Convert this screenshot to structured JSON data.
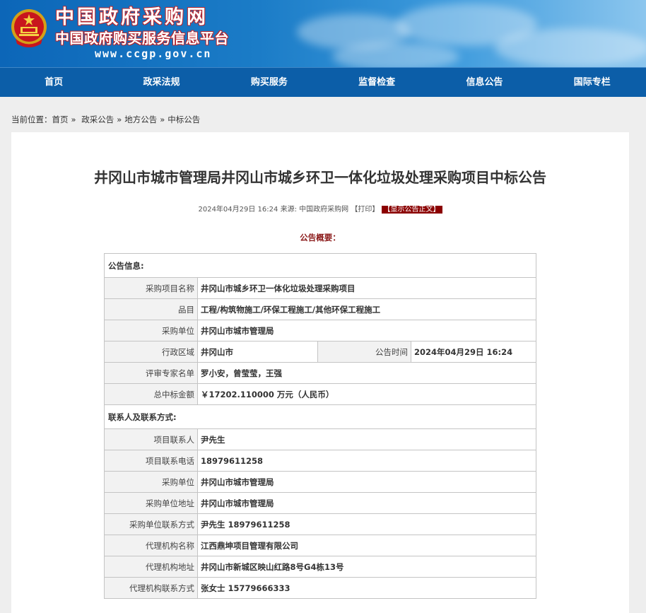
{
  "header": {
    "title_cn": "中国政府采购网",
    "subtitle_cn": "中国政府购买服务信息平台",
    "url": "www.ccgp.gov.cn"
  },
  "nav": [
    "首页",
    "政采法规",
    "购买服务",
    "监督检查",
    "信息公告",
    "国际专栏"
  ],
  "breadcrumb": {
    "label": "当前位置：",
    "items": [
      "首页",
      "政采公告",
      "地方公告",
      "中标公告"
    ]
  },
  "article": {
    "title": "井冈山市城市管理局井冈山市城乡环卫一体化垃圾处理采购项目中标公告",
    "date": "2024年04月29日 16:24",
    "source_label": "来源:",
    "source": "中国政府采购网",
    "print": "【打印】",
    "show_text": "【显示公告正文】",
    "summary_label": "公告概要："
  },
  "info": {
    "section1": "公告信息:",
    "project_name_label": "采购项目名称",
    "project_name": "井冈山市城乡环卫一体化垃圾处理采购项目",
    "category_label": "品目",
    "category": "工程/构筑物施工/环保工程施工/其他环保工程施工",
    "buyer_label": "采购单位",
    "buyer": "井冈山市城市管理局",
    "region_label": "行政区域",
    "region": "井冈山市",
    "publish_time_label": "公告时间",
    "publish_time": "2024年04月29日  16:24",
    "experts_label": "评审专家名单",
    "experts": "罗小安，曾莹莹，王强",
    "amount_label": "总中标金额",
    "amount": "￥17202.110000 万元（人民币）",
    "section2": "联系人及联系方式:",
    "contact_label": "项目联系人",
    "contact": "尹先生",
    "phone_label": "项目联系电话",
    "phone": "18979611258",
    "buyer2_label": "采购单位",
    "buyer2": "井冈山市城市管理局",
    "buyer_addr_label": "采购单位地址",
    "buyer_addr": "井冈山市城市管理局",
    "buyer_contact_label": "采购单位联系方式",
    "buyer_contact": "尹先生 18979611258",
    "agency_label": "代理机构名称",
    "agency": "江西鼎坤项目管理有限公司",
    "agency_addr_label": "代理机构地址",
    "agency_addr": "井冈山市新城区映山红路8号G4栋13号",
    "agency_contact_label": "代理机构联系方式",
    "agency_contact": "张女士 15779666333"
  },
  "colors": {
    "nav_bg": "#0c5ea8",
    "banner": "#1b7cc7",
    "accent_red": "#8b0000"
  }
}
